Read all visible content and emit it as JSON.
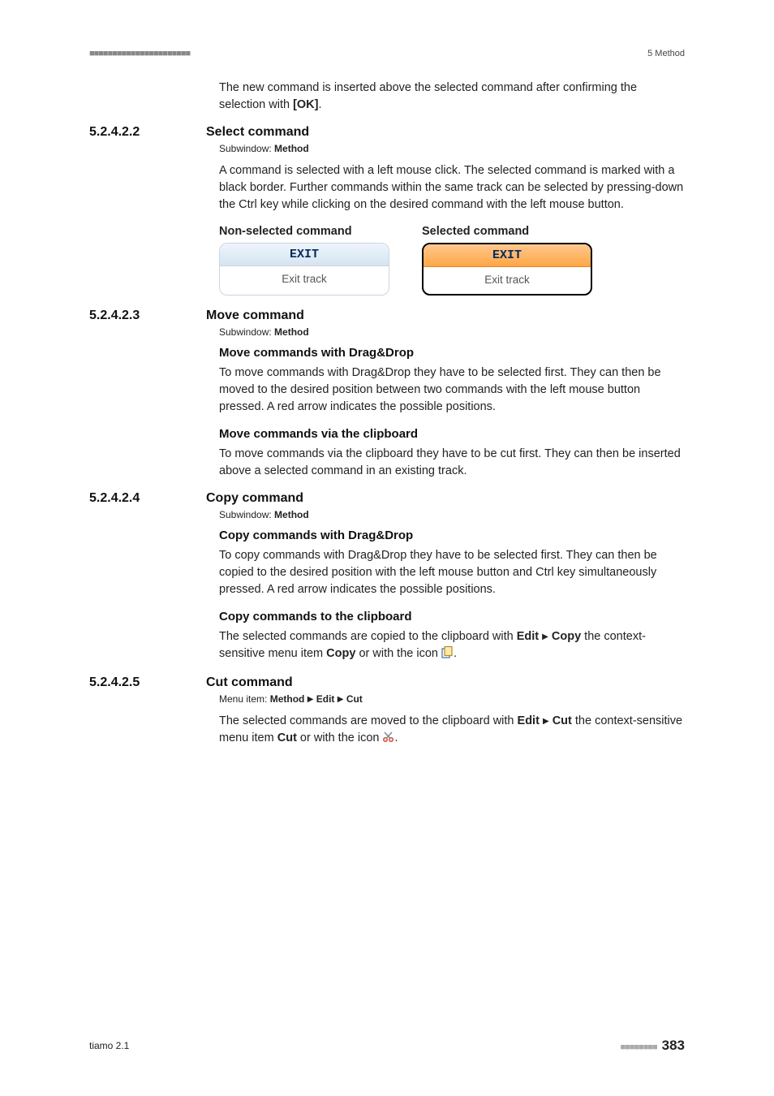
{
  "header": {
    "dots": "■■■■■■■■■■■■■■■■■■■■■■",
    "chapter": "5 Method"
  },
  "intro": "The new command is inserted above the selected command after confirming the selection with ",
  "intro_bold": "[OK]",
  "intro_tail": ".",
  "subwindow_label_prefix": "Subwindow: ",
  "subwindow_value": "Method",
  "menu_label_prefix": "Menu item: ",
  "s1": {
    "num": "5.2.4.2.2",
    "title": "Select command",
    "para": "A command is selected with a left mouse click. The selected command is marked with a black border. Further commands within the same track can be selected by pressing-down the Ctrl key while clicking on the desired command with the left mouse button."
  },
  "table": {
    "head_left": "Non-selected command",
    "head_right": "Selected command",
    "card_top": "EXIT",
    "card_bottom": "Exit track"
  },
  "s2": {
    "num": "5.2.4.2.3",
    "title": "Move command",
    "h1": "Move commands with Drag&Drop",
    "p1": "To move commands with Drag&Drop they have to be selected first. They can then be moved to the desired position between two commands with the left mouse button pressed. A red arrow indicates the possible positions.",
    "h2": "Move commands via the clipboard",
    "p2": "To move commands via the clipboard they have to be cut first. They can then be inserted above a selected command in an existing track."
  },
  "s3": {
    "num": "5.2.4.2.4",
    "title": "Copy command",
    "h1": "Copy commands with Drag&Drop",
    "p1": "To copy commands with Drag&Drop they have to be selected first. They can then be copied to the desired position with the left mouse button and Ctrl key simultaneously pressed. A red arrow indicates the possible positions.",
    "h2": "Copy commands to the clipboard",
    "p2a": "The selected commands are copied to the clipboard with ",
    "p2_edit": "Edit",
    "p2_copy": "Copy",
    "p2b": " the context-sensitive menu item ",
    "p2_copy2": "Copy",
    "p2c": " or with the icon ",
    "p2d": "."
  },
  "s4": {
    "num": "5.2.4.2.5",
    "title": "Cut command",
    "menu_method": "Method",
    "menu_edit": "Edit",
    "menu_cut": "Cut",
    "p1a": "The selected commands are moved to the clipboard with ",
    "p1_edit": "Edit",
    "p1_cut": "Cut",
    "p1b": " the context-sensitive menu item ",
    "p1_cut2": "Cut",
    "p1c": " or with the icon ",
    "p1d": "."
  },
  "footer": {
    "left": "tiamo 2.1",
    "dots": "■■■■■■■■",
    "page": "383"
  }
}
